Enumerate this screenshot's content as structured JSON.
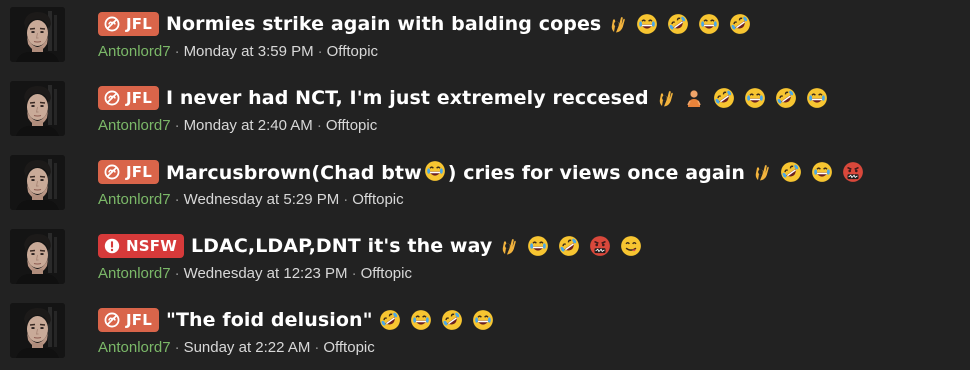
{
  "colors": {
    "background": "#222222",
    "prefix_jfl": "#d9654a",
    "prefix_nsfw": "#d63a3a",
    "author": "#7bb868",
    "meta_text": "#d8d8d8"
  },
  "threads": [
    {
      "prefix": "JFL",
      "prefix_icon": "broken-heart-icon",
      "title": "Normies strike again with balding copes",
      "emojis": [
        "ok-hand-emoji",
        "grinning-emoji",
        "rofl-emoji",
        "grinning-emoji",
        "rofl-emoji"
      ],
      "author": "Antonlord7",
      "date": "Monday at 3:59 PM",
      "forum": "Offtopic"
    },
    {
      "prefix": "JFL",
      "prefix_icon": "broken-heart-icon",
      "title": "I never had NCT, I'm just extremely reccesed",
      "emojis": [
        "ok-hand-emoji",
        "person-emoji",
        "rofl-emoji",
        "grinning-emoji",
        "rofl-emoji",
        "grinning-emoji"
      ],
      "author": "Antonlord7",
      "date": "Monday at 2:40 AM",
      "forum": "Offtopic"
    },
    {
      "prefix": "JFL",
      "prefix_icon": "broken-heart-icon",
      "title_before": "Marcusbrown(Chad btw",
      "title_after": ") cries for views once again",
      "emojis": [
        "ok-hand-emoji",
        "rofl-emoji",
        "grinning-emoji",
        "cursing-emoji"
      ],
      "author": "Antonlord7",
      "date": "Wednesday at 5:29 PM",
      "forum": "Offtopic"
    },
    {
      "prefix": "NSFW",
      "prefix_icon": "exclamation-icon",
      "title": "LDAC,LDAP,DNT it's the way",
      "emojis": [
        "ok-hand-emoji",
        "grinning-emoji",
        "rofl-emoji",
        "cursing-emoji",
        "yum-emoji"
      ],
      "author": "Antonlord7",
      "date": "Wednesday at 12:23 PM",
      "forum": "Offtopic"
    },
    {
      "prefix": "JFL",
      "prefix_icon": "broken-heart-icon",
      "title": "\"The foid delusion\"",
      "emojis": [
        "rofl-emoji",
        "grinning-emoji",
        "rofl-emoji",
        "grinning-emoji"
      ],
      "author": "Antonlord7",
      "date": "Sunday at 2:22 AM",
      "forum": "Offtopic"
    }
  ]
}
